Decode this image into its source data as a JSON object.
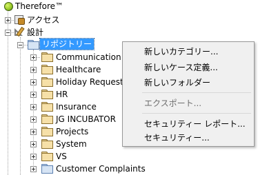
{
  "tree": {
    "root": {
      "label": "Therefore™"
    },
    "access": {
      "label": "アクセス"
    },
    "design": {
      "label": "設計"
    },
    "repository": {
      "label": "リポジトリー"
    },
    "folders": [
      {
        "label": "Communication"
      },
      {
        "label": "Healthcare"
      },
      {
        "label": "Holiday Requests"
      },
      {
        "label": "HR"
      },
      {
        "label": "Insurance"
      },
      {
        "label": "JG INCUBATOR"
      },
      {
        "label": "Projects"
      },
      {
        "label": "System"
      },
      {
        "label": "VS"
      },
      {
        "label": "Customer Complaints"
      }
    ]
  },
  "context_menu": {
    "items": [
      {
        "label": "新しいカテゴリー...",
        "enabled": true
      },
      {
        "label": "新しいケース定義...",
        "enabled": true
      },
      {
        "label": "新しいフォルダー",
        "enabled": true
      },
      {
        "label": "エクスポート...",
        "enabled": false
      },
      {
        "label": "セキュリティー レポート...",
        "enabled": true
      },
      {
        "label": "セキュリティー...",
        "enabled": true
      }
    ]
  }
}
